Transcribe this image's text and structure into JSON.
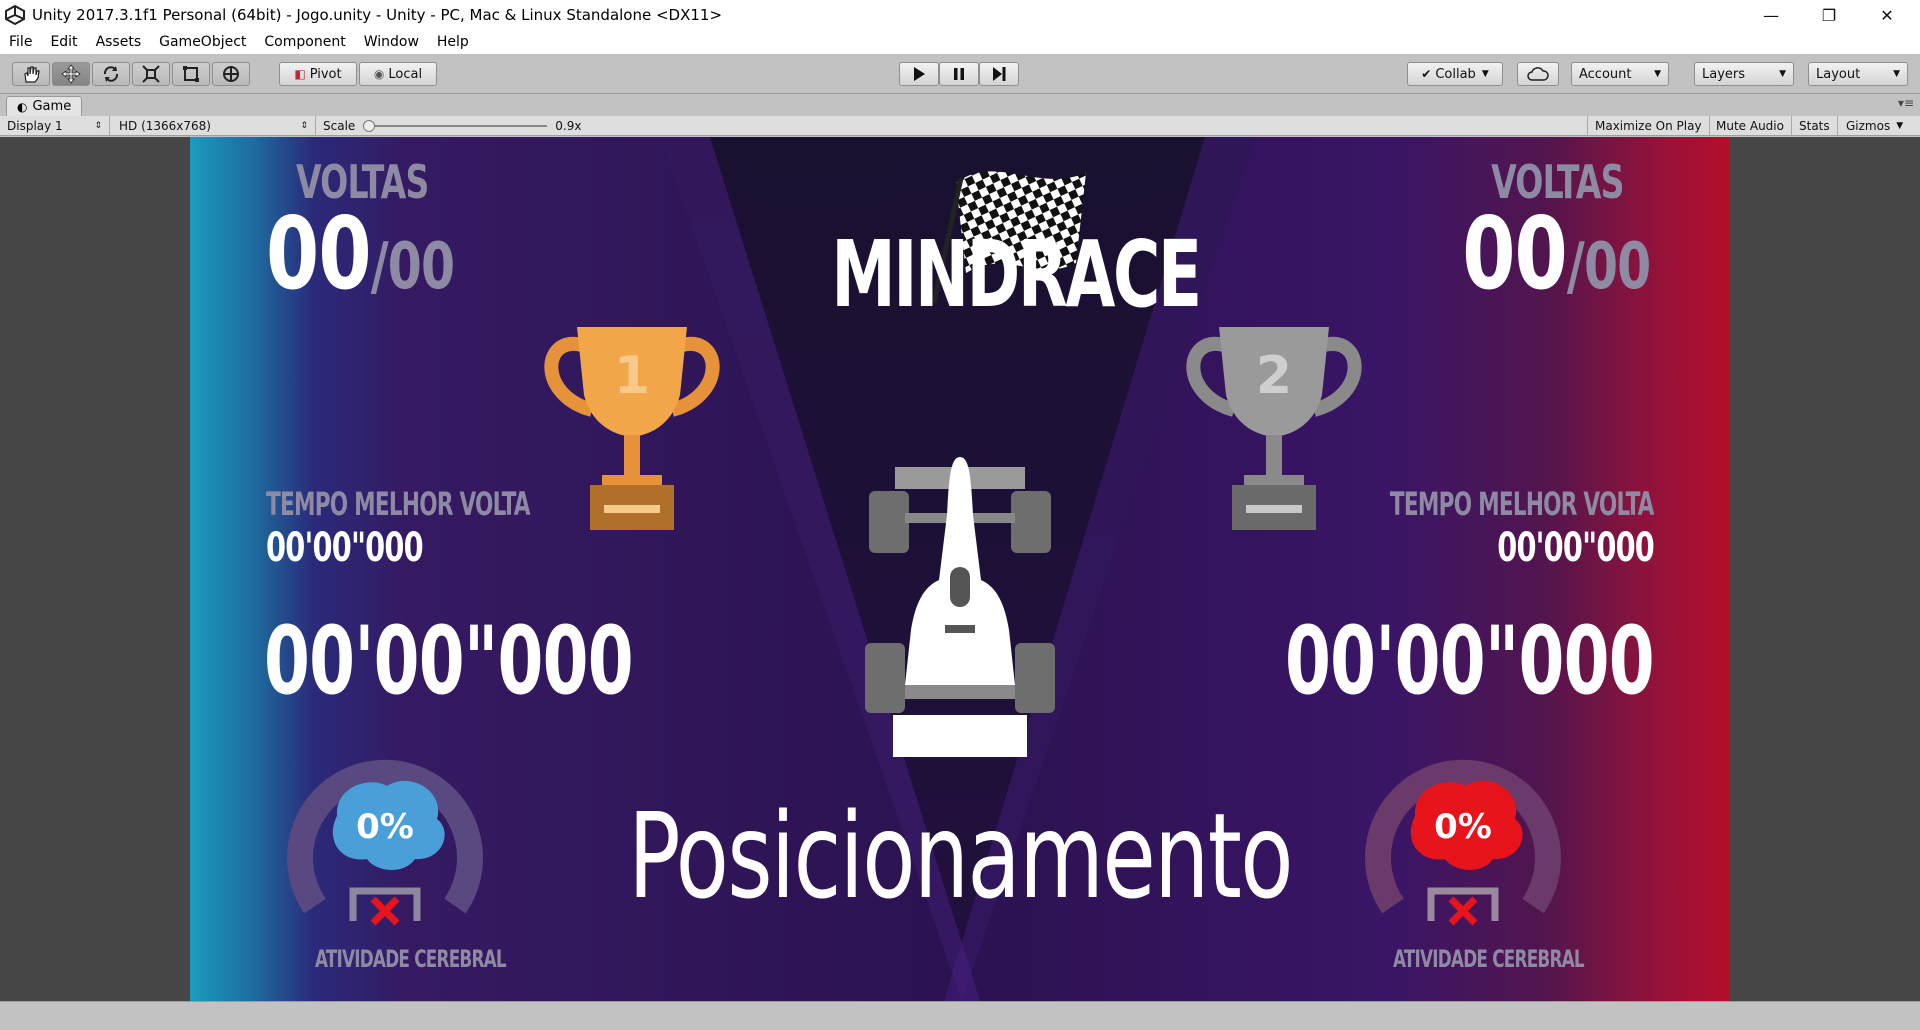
{
  "window": {
    "title": "Unity 2017.3.1f1 Personal (64bit) - Jogo.unity - Unity - PC, Mac & Linux Standalone <DX11>",
    "minimize": "—",
    "maximize": "❐",
    "close": "✕"
  },
  "menu": [
    "File",
    "Edit",
    "Assets",
    "GameObject",
    "Component",
    "Window",
    "Help"
  ],
  "toolbar": {
    "pivot": "Pivot",
    "local": "Local",
    "collab": "Collab",
    "account": "Account",
    "layers": "Layers",
    "layout": "Layout"
  },
  "game_panel": {
    "tab": "Game",
    "display": "Display 1",
    "resolution": "HD (1366x768)",
    "scale_label": "Scale",
    "scale_value": "0.9x",
    "scale_fraction": 0.0,
    "maximize_on_play": "Maximize On Play",
    "mute_audio": "Mute Audio",
    "stats": "Stats",
    "gizmos": "Gizmos"
  },
  "hud": {
    "title": "MINDRACE",
    "subtitle": "Posicionamento",
    "player1": {
      "laps_label": "VOLTAS",
      "laps": "00",
      "laps_total": "/00",
      "position": "1",
      "best_lap_label": "TEMPO MELHOR VOLTA",
      "best_lap": "00'00\"000",
      "time": "00'00\"000",
      "brain_activity": "0%",
      "brain_label": "ATIVIDADE CEREBRAL",
      "brain_color": "#4a9fd8",
      "trophy_color": "#f2a64a"
    },
    "player2": {
      "laps_label": "VOLTAS",
      "laps": "00",
      "laps_total": "/00",
      "position": "2",
      "best_lap_label": "TEMPO MELHOR VOLTA",
      "best_lap": "00'00\"000",
      "time": "00'00\"000",
      "brain_activity": "0%",
      "brain_label": "ATIVIDADE CEREBRAL",
      "brain_color": "#e8141c",
      "trophy_color": "#9a9a9a"
    }
  }
}
